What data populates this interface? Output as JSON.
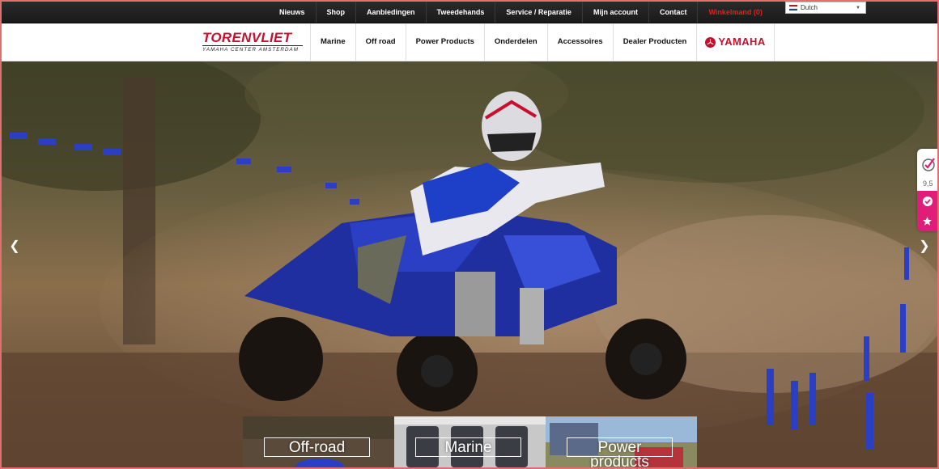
{
  "topbar": {
    "nav": [
      "Nieuws",
      "Shop",
      "Aanbiedingen",
      "Tweedehands",
      "Service / Reparatie",
      "Mijn account",
      "Contact"
    ],
    "cart_label": "Winkelmand (0)",
    "language": {
      "selected": "Dutch",
      "icon": "netherlands-flag-icon"
    }
  },
  "header": {
    "logo": {
      "title": "TORENVLIET",
      "subtitle": "YAMAHA CENTER AMSTERDAM"
    },
    "nav": [
      "Marine",
      "Off road",
      "Power Products",
      "Onderdelen",
      "Accessoires",
      "Dealer Producten"
    ],
    "brand": "YAMAHA"
  },
  "hero": {
    "prev_icon": "chevron-left-icon",
    "next_icon": "chevron-right-icon"
  },
  "review_widget": {
    "score": "9,5",
    "icons": [
      "checkmark-logo-icon",
      "check-circle-icon",
      "star-icon"
    ],
    "color": "#e01e79"
  },
  "categories": [
    {
      "label": "Off-road"
    },
    {
      "label": "Marine"
    },
    {
      "label_line1": "Power",
      "label_line2": "products"
    }
  ],
  "colors": {
    "accent": "#c8102e",
    "cart": "#e02020",
    "widget": "#e01e79"
  }
}
